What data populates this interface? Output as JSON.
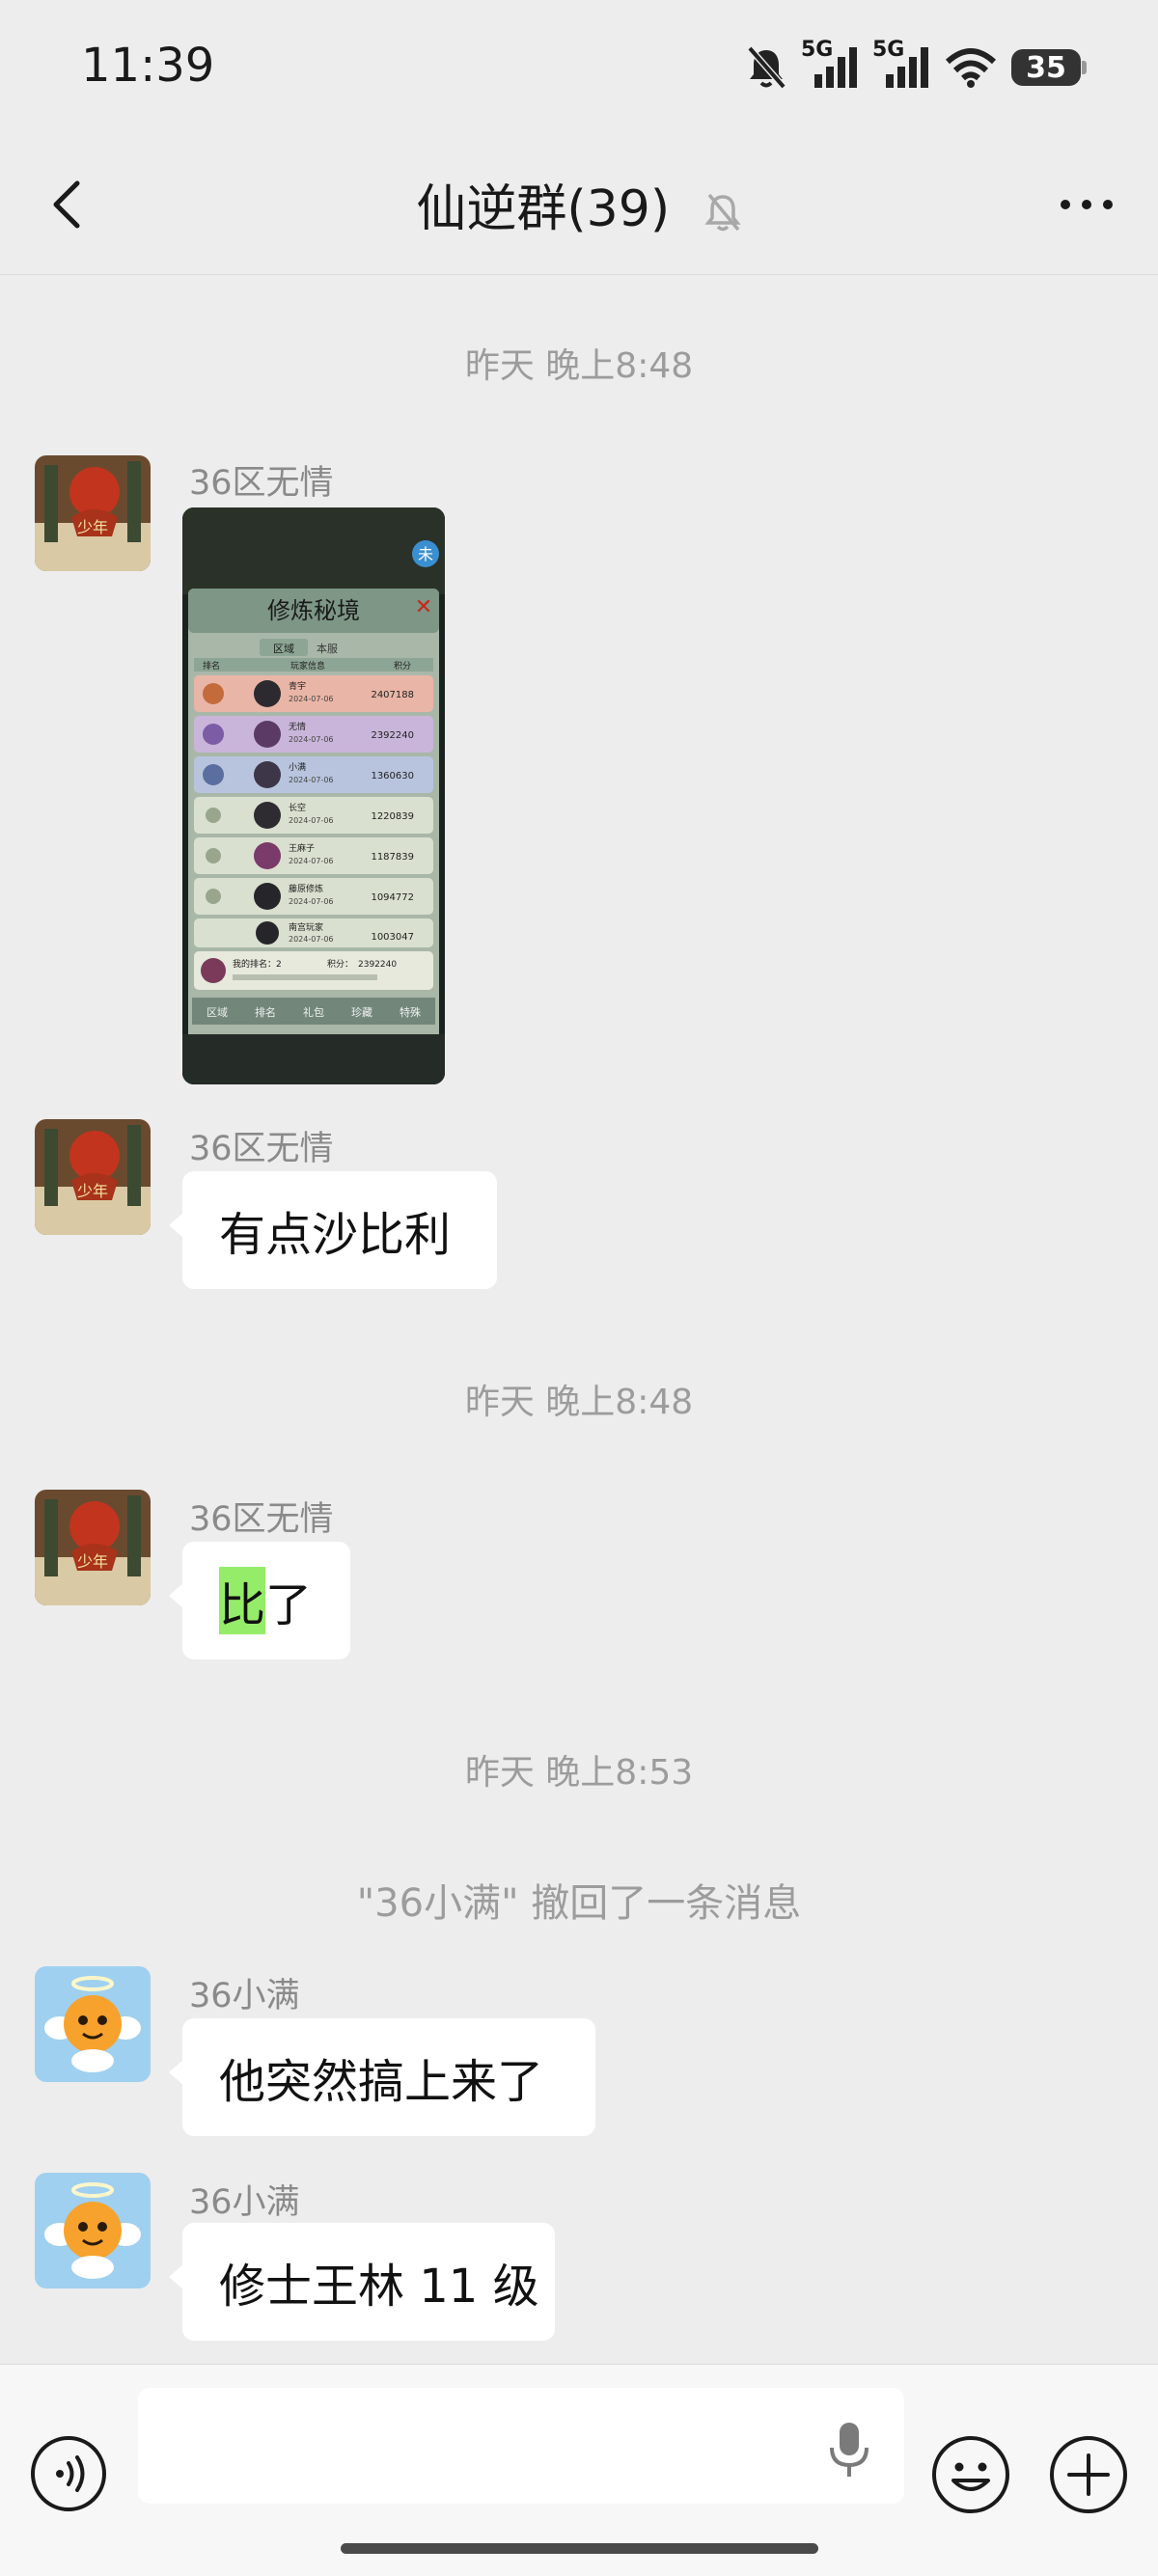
{
  "status_bar": {
    "time": "11:39",
    "network_1": "5G",
    "network_2": "5G",
    "battery": "35",
    "icons": [
      "bell-off-icon",
      "signal-icon",
      "signal-icon",
      "wifi-icon",
      "battery-icon"
    ]
  },
  "header": {
    "title": "仙逆群(39)",
    "back_icon": "chevron-left-icon",
    "mute_icon": "bell-off-icon",
    "more_icon": "more-dots-icon"
  },
  "messages": {
    "timestamp_1": "昨天 晚上8:48",
    "msg1_sender": "36区无情",
    "msg2_sender": "36区无情",
    "msg2_text": "有点沙比利",
    "timestamp_2": "昨天 晚上8:48",
    "msg3_sender": "36区无情",
    "msg3_text_highlight": "比",
    "msg3_text_rest": "了",
    "timestamp_3": "昨天 晚上8:53",
    "recall_notice": "\"36小满\" 撤回了一条消息",
    "msg4_sender": "36小满",
    "msg4_text": "他突然搞上来了",
    "msg5_sender": "36小满",
    "msg5_text": "修士王林 11 级"
  },
  "game_screenshot": {
    "title": "修炼秘境",
    "tabs": [
      "区域",
      "本服"
    ],
    "columns": [
      "排名",
      "玩家信息",
      "积分"
    ],
    "rows": [
      {
        "name": "青宇",
        "date": "2024-07-06",
        "score": "2407188"
      },
      {
        "name": "无情",
        "date": "2024-07-06",
        "score": "2392240"
      },
      {
        "name": "小满",
        "date": "2024-07-06",
        "score": "1360630"
      },
      {
        "name": "长空",
        "date": "2024-07-06",
        "score": "1220839"
      },
      {
        "name": "王麻子",
        "date": "2024-07-06",
        "score": "1187839"
      },
      {
        "name": "藤原修炼",
        "date": "2024-07-06",
        "score": "1094772"
      },
      {
        "name": "南宫玩家",
        "date": "2024-07-06",
        "score": "1003047"
      }
    ],
    "my_rank_label": "我的排名：2",
    "my_score_label": "积分：",
    "my_score": "2392240",
    "bottom_tabs": [
      "区域",
      "排名",
      "礼包",
      "珍藏",
      "特殊"
    ],
    "badge": "未"
  },
  "input_bar": {
    "placeholder": "",
    "voice_icon": "voice-icon",
    "mic_icon": "mic-icon",
    "emoji_icon": "emoji-icon",
    "plus_icon": "plus-circle-icon"
  }
}
